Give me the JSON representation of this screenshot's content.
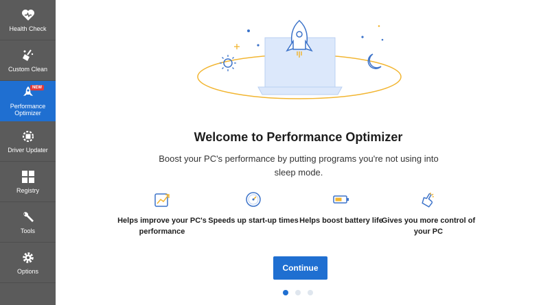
{
  "sidebar": {
    "items": [
      {
        "label": "Health Check",
        "icon": "heart-icon"
      },
      {
        "label": "Custom Clean",
        "icon": "broom-icon"
      },
      {
        "label": "Performance Optimizer",
        "icon": "rocket-icon",
        "badge": "NEW",
        "active": true
      },
      {
        "label": "Driver Updater",
        "icon": "chip-icon"
      },
      {
        "label": "Registry",
        "icon": "grid-icon"
      },
      {
        "label": "Tools",
        "icon": "wrench-icon"
      },
      {
        "label": "Options",
        "icon": "gear-icon"
      }
    ]
  },
  "main": {
    "title": "Welcome to Performance Optimizer",
    "subtitle": "Boost your PC's performance by putting programs you're not using into sleep mode.",
    "features": [
      {
        "text": "Helps improve your PC's performance",
        "icon": "chart-up-icon"
      },
      {
        "text": "Speeds up start-up times",
        "icon": "speedometer-icon"
      },
      {
        "text": "Helps boost battery life",
        "icon": "battery-icon"
      },
      {
        "text": "Gives you more control of your PC",
        "icon": "hand-click-icon"
      }
    ],
    "continue_label": "Continue",
    "pagination": {
      "total": 3,
      "current": 1
    }
  },
  "colors": {
    "sidebar_bg": "#5b5b5b",
    "accent": "#1f6fd1",
    "badge": "#e33b3b",
    "orbit": "#f2b530"
  }
}
